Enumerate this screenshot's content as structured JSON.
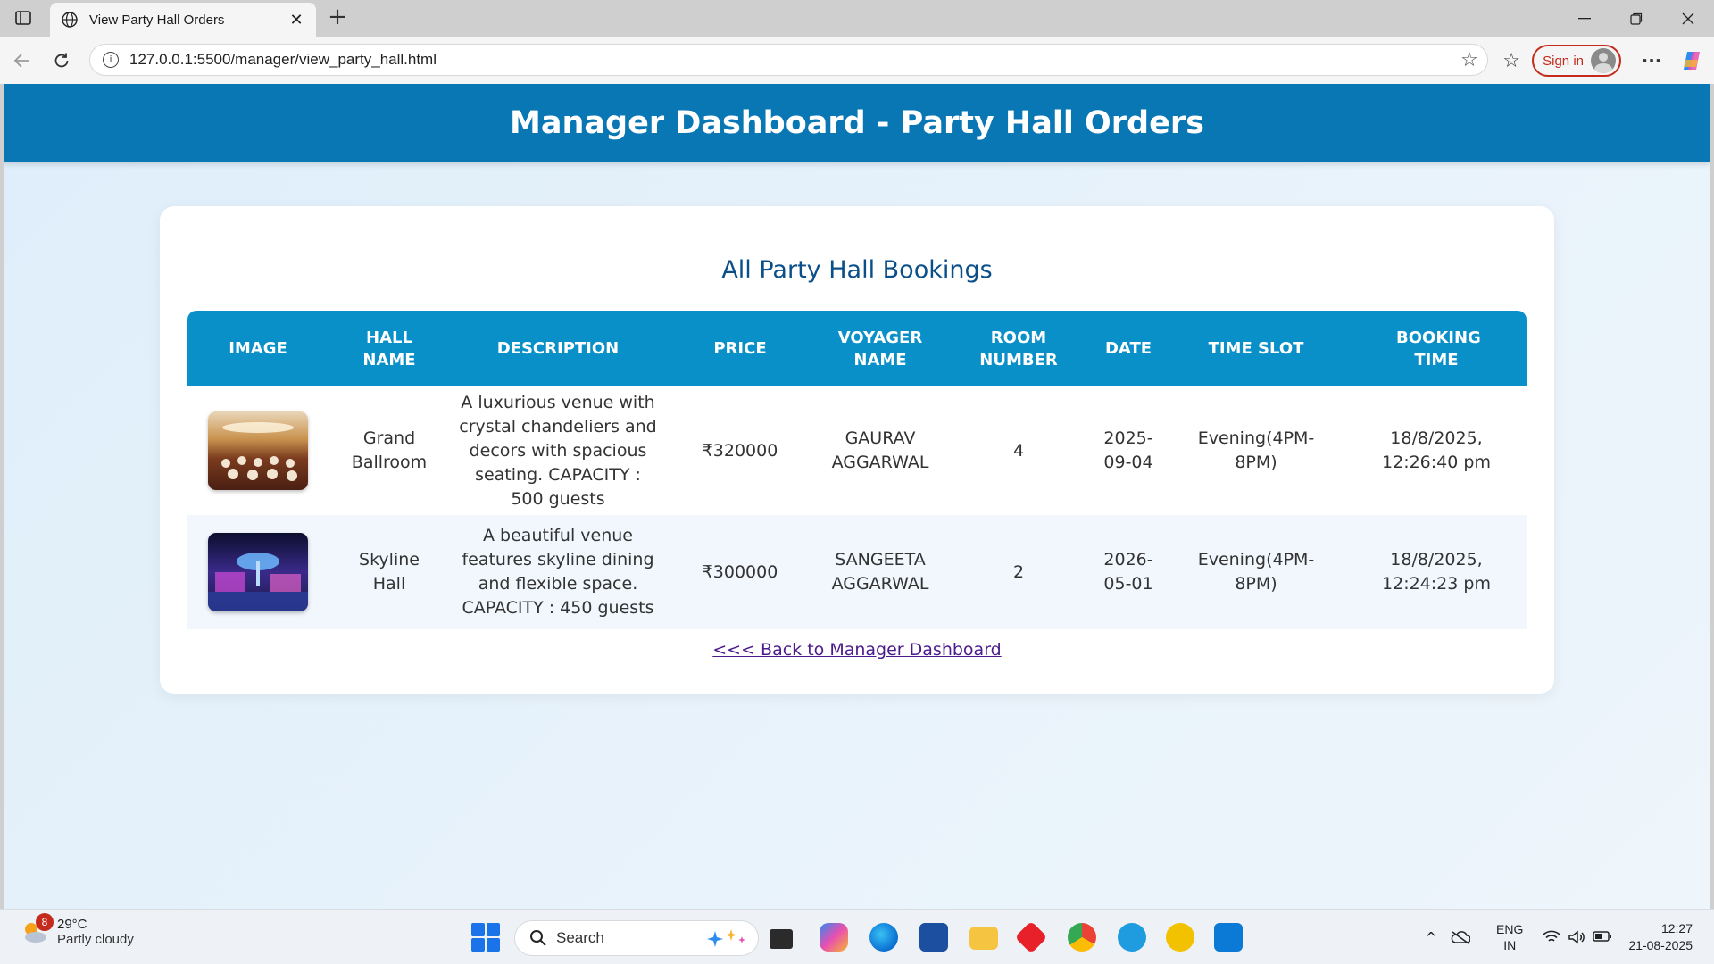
{
  "browser": {
    "tab_title": "View Party Hall Orders",
    "tab_close": "✕",
    "new_tab": "+",
    "url": "127.0.0.1:5500/manager/view_party_hall.html",
    "signin_label": "Sign in",
    "menu": "···",
    "icons": {
      "back": "back-arrow-icon",
      "reload": "reload-icon",
      "info": "site-info-icon",
      "favorite": "star-icon",
      "favorites": "favorites-icon",
      "copilot": "copilot-icon"
    }
  },
  "page": {
    "header_title": "Manager Dashboard - Party Hall Orders",
    "header_color": "#0a77b5",
    "card_title": "All Party Hall Bookings",
    "table_header_color": "#0a90c8",
    "columns": [
      "IMAGE",
      "HALL NAME",
      "DESCRIPTION",
      "PRICE",
      "VOYAGER NAME",
      "ROOM NUMBER",
      "DATE",
      "TIME SLOT",
      "BOOKING TIME"
    ],
    "rows": [
      {
        "image": "ballroom-photo",
        "hall_name": "Grand Ballroom",
        "description": "A luxurious venue with crystal chandeliers and decors with spacious seating. CAPACITY : 500 guests",
        "price": "₹320000",
        "voyager_name": "GAURAV AGGARWAL",
        "room_number": "4",
        "date": "2025-09-04",
        "time_slot": "Evening(4PM-8PM)",
        "booking_time": "18/8/2025, 12:26:40 pm"
      },
      {
        "image": "skyline-hall-photo",
        "hall_name": "Skyline Hall",
        "description": "A beautiful venue features skyline dining and flexible space. CAPACITY : 450 guests",
        "price": "₹300000",
        "voyager_name": "SANGEETA AGGARWAL",
        "room_number": "2",
        "date": "2026-05-01",
        "time_slot": "Evening(4PM-8PM)",
        "booking_time": "18/8/2025, 12:24:23 pm"
      }
    ],
    "back_link": "<<< Back to Manager Dashboard"
  },
  "taskbar": {
    "weather_badge": "8",
    "temperature": "29°C",
    "weather_text": "Partly cloudy",
    "search_label": "Search",
    "lang_line1": "ENG",
    "lang_line2": "IN",
    "time": "12:27",
    "date": "21-08-2025"
  }
}
